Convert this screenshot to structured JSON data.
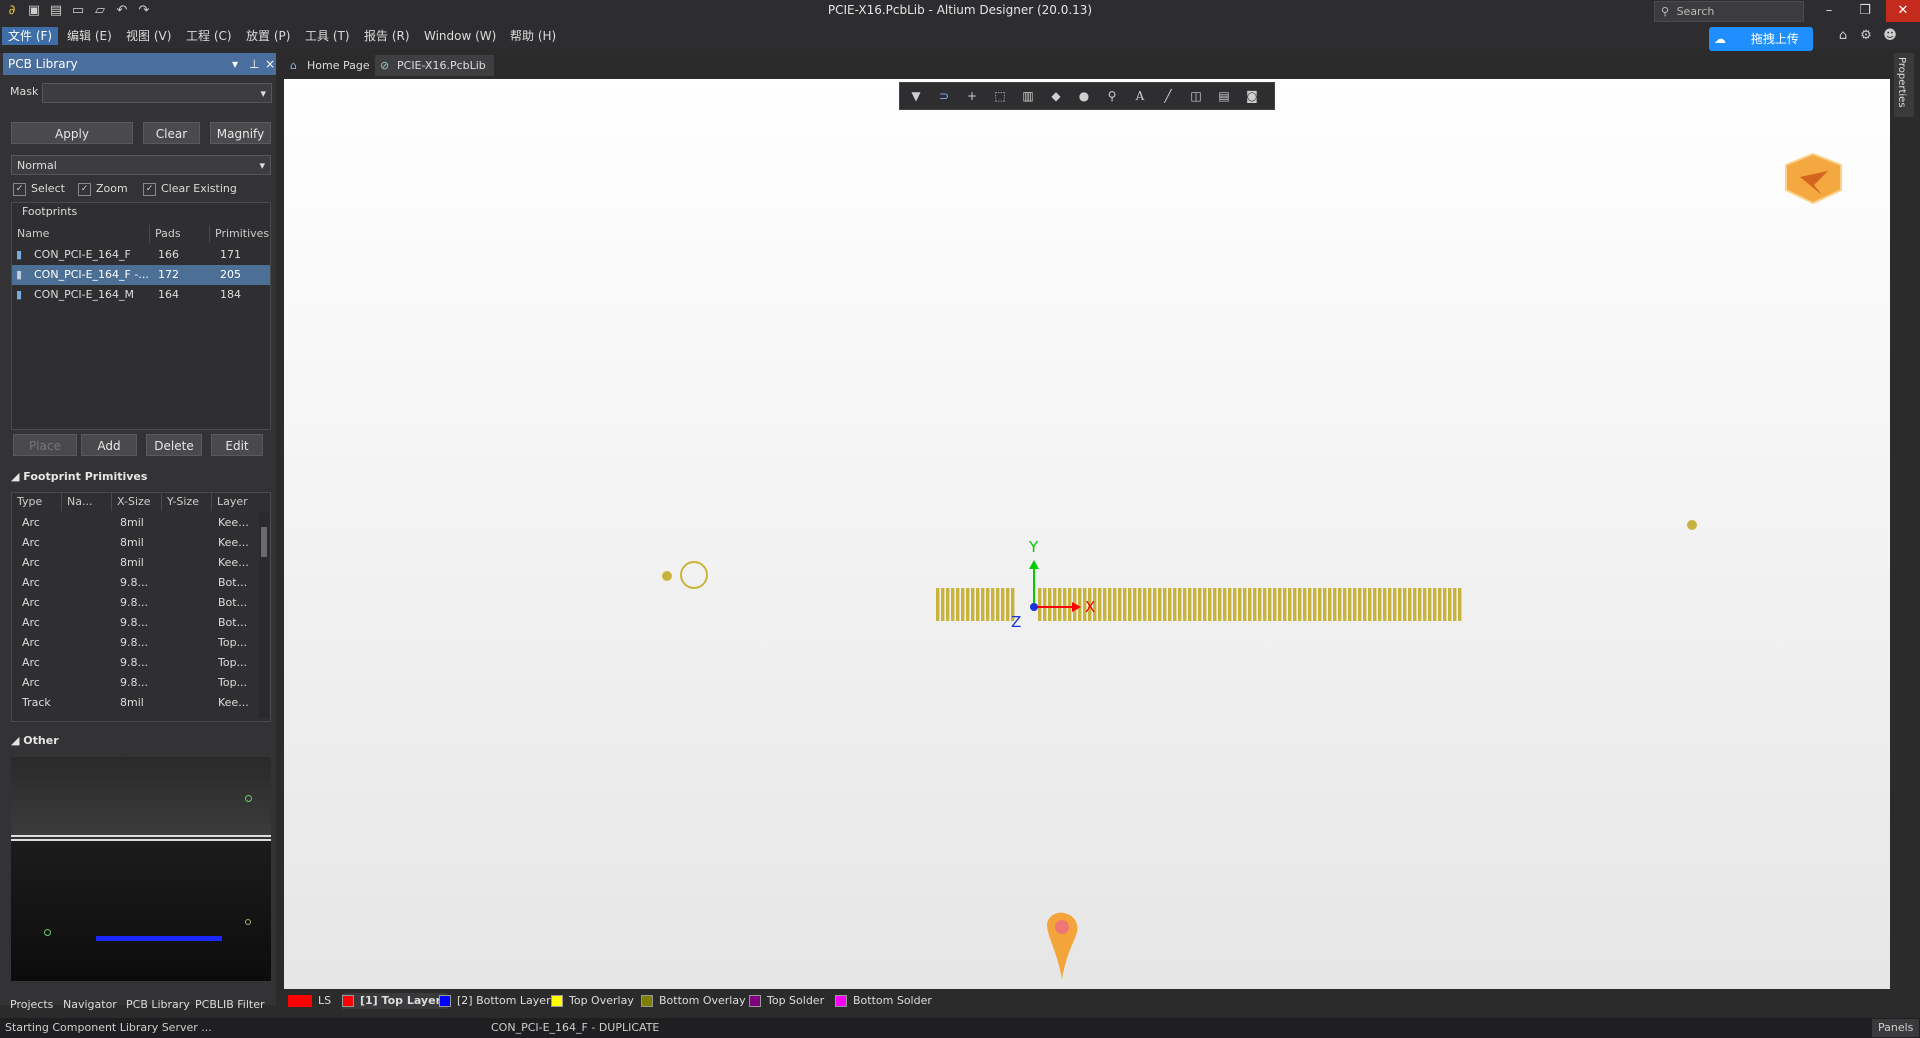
{
  "window": {
    "title": "PCIE-X16.PcbLib - Altium Designer (20.0.13)",
    "search_placeholder": "Search",
    "upload_label": "拖拽上传"
  },
  "menu": [
    {
      "label": "文件 (F)",
      "active": true
    },
    {
      "label": "编辑 (E)"
    },
    {
      "label": "视图 (V)"
    },
    {
      "label": "工程 (C)"
    },
    {
      "label": "放置 (P)"
    },
    {
      "label": "工具 (T)"
    },
    {
      "label": "报告 (R)"
    },
    {
      "label": "Window (W)"
    },
    {
      "label": "帮助 (H)"
    }
  ],
  "panel": {
    "title": "PCB Library",
    "mask_label": "Mask",
    "apply": "Apply",
    "clear": "Clear",
    "magnify": "Magnify",
    "mode": "Normal",
    "checks": [
      {
        "label": "Select",
        "checked": true
      },
      {
        "label": "Zoom",
        "checked": true
      },
      {
        "label": "Clear Existing",
        "checked": true
      }
    ],
    "footprints_label": "Footprints",
    "footprint_columns": [
      "Name",
      "Pads",
      "Primitives"
    ],
    "footprints": [
      {
        "name": "CON_PCI-E_164_F",
        "pads": "166",
        "primitives": "171",
        "selected": false
      },
      {
        "name": "CON_PCI-E_164_F -...",
        "pads": "172",
        "primitives": "205",
        "selected": true
      },
      {
        "name": "CON_PCI-E_164_M",
        "pads": "164",
        "primitives": "184",
        "selected": false
      }
    ],
    "place": "Place",
    "add": "Add",
    "delete": "Delete",
    "edit": "Edit",
    "primitives_label": "Footprint Primitives",
    "primitive_columns": [
      "Type",
      "Na...",
      "X-Size",
      "Y-Size",
      "Layer"
    ],
    "primitives": [
      {
        "type": "Arc",
        "xsize": "8mil",
        "layer": "Kee..."
      },
      {
        "type": "Arc",
        "xsize": "8mil",
        "layer": "Kee..."
      },
      {
        "type": "Arc",
        "xsize": "8mil",
        "layer": "Kee..."
      },
      {
        "type": "Arc",
        "xsize": "9.8...",
        "layer": "Bot..."
      },
      {
        "type": "Arc",
        "xsize": "9.8...",
        "layer": "Bot..."
      },
      {
        "type": "Arc",
        "xsize": "9.8...",
        "layer": "Bot..."
      },
      {
        "type": "Arc",
        "xsize": "9.8...",
        "layer": "Top..."
      },
      {
        "type": "Arc",
        "xsize": "9.8...",
        "layer": "Top..."
      },
      {
        "type": "Arc",
        "xsize": "9.8...",
        "layer": "Top..."
      },
      {
        "type": "Track",
        "xsize": "8mil",
        "layer": "Kee..."
      }
    ],
    "other_label": "Other",
    "bottom_tabs": [
      "Projects",
      "Navigator",
      "PCB Library",
      "PCBLIB Filter"
    ]
  },
  "doc_tabs": [
    {
      "label": "Home Page",
      "icon": "home-icon"
    },
    {
      "label": "PCIE-X16.PcbLib",
      "icon": "pcblib-icon",
      "active": true
    }
  ],
  "axis": {
    "x": "X",
    "y": "Y",
    "z": "Z"
  },
  "layers": [
    {
      "label": "LS",
      "color": "#ff0000"
    },
    {
      "label": "[1] Top Layer",
      "color": "#ff0000",
      "bold": true
    },
    {
      "label": "[2] Bottom Layer",
      "color": "#0000ff"
    },
    {
      "label": "Top Overlay",
      "color": "#ffff00"
    },
    {
      "label": "Bottom Overlay",
      "color": "#808000"
    },
    {
      "label": "Top Solder",
      "color": "#800080"
    },
    {
      "label": "Bottom Solder",
      "color": "#ff00ff"
    }
  ],
  "status": {
    "left": "Starting Component Library Server ...",
    "center": "CON_PCI-E_164_F - DUPLICATE",
    "panels": "Panels"
  },
  "right_tab": "Properties",
  "colors": {
    "accent": "#4a6f9e",
    "pad": "#c8b43c",
    "close": "#c42b1c"
  }
}
